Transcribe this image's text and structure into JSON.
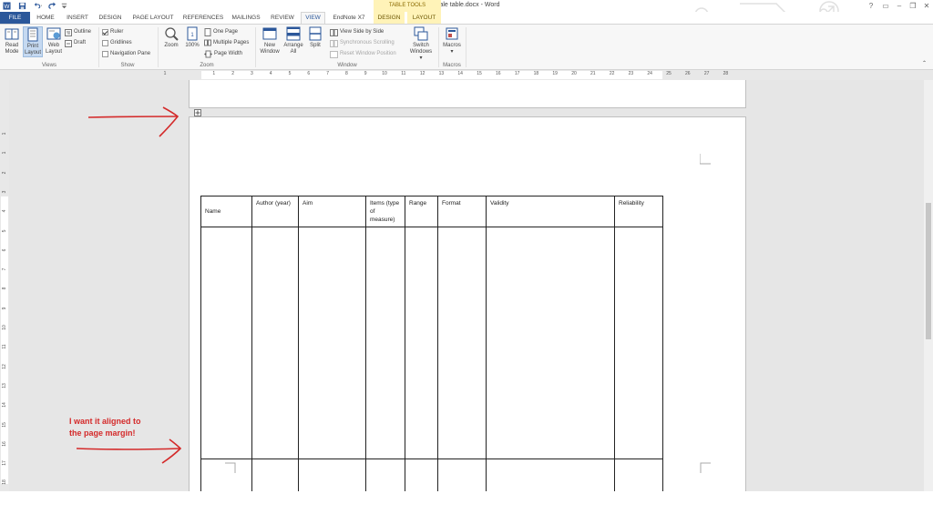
{
  "title_bar": {
    "document_title": "scale table.docx - Word",
    "table_tools": "TABLE TOOLS",
    "help": "?",
    "restore_ribbon": "▭",
    "minimize": "–",
    "maximize": "❐",
    "close": "✕"
  },
  "tabs": {
    "file": "FILE",
    "home": "HOME",
    "insert": "INSERT",
    "design": "DESIGN",
    "page_layout": "PAGE LAYOUT",
    "references": "REFERENCES",
    "mailings": "MAILINGS",
    "review": "REVIEW",
    "view": "VIEW",
    "endnote": "EndNote X7",
    "tt_design": "DESIGN",
    "tt_layout": "LAYOUT"
  },
  "ribbon": {
    "views": {
      "read_mode": [
        "Read",
        "Mode"
      ],
      "print_layout": [
        "Print",
        "Layout"
      ],
      "web_layout": [
        "Web",
        "Layout"
      ],
      "outline": "Outline",
      "draft": "Draft",
      "label": "Views"
    },
    "show": {
      "ruler": "Ruler",
      "gridlines": "Gridlines",
      "navigation_pane": "Navigation Pane",
      "label": "Show",
      "ruler_checked": true,
      "gridlines_checked": false,
      "navigation_checked": false
    },
    "zoom": {
      "zoom": "Zoom",
      "hundred": "100%",
      "one_page": "One Page",
      "multiple_pages": "Multiple Pages",
      "page_width": "Page Width",
      "label": "Zoom"
    },
    "window": {
      "new_window": [
        "New",
        "Window"
      ],
      "arrange_all": [
        "Arrange",
        "All"
      ],
      "split": "Split",
      "view_side_by_side": "View Side by Side",
      "synchronous_scrolling": "Synchronous Scrolling",
      "reset_window_position": "Reset Window Position",
      "switch_windows": [
        "Switch",
        "Windows ▾"
      ],
      "label": "Window"
    },
    "macros": {
      "macros": [
        "Macros",
        "▾"
      ],
      "label": "Macros"
    }
  },
  "ruler": {
    "h_numbers": [
      "1",
      "1",
      "2",
      "3",
      "4",
      "5",
      "6",
      "7",
      "8",
      "9",
      "10",
      "11",
      "12",
      "13",
      "14",
      "15",
      "16",
      "17",
      "18",
      "19",
      "20",
      "21",
      "22",
      "23",
      "24",
      "25",
      "26",
      "27",
      "28"
    ],
    "v_numbers": [
      "1",
      "1",
      "2",
      "3",
      "4",
      "5",
      "6",
      "7",
      "8",
      "9",
      "10",
      "11",
      "12",
      "13",
      "14",
      "15",
      "16",
      "17",
      "18",
      "19"
    ]
  },
  "table": {
    "headers": [
      "Name",
      "Author (year)",
      "Aim",
      "Items (type of measure)",
      "Range",
      "Format",
      "Validity",
      "Reliability"
    ]
  },
  "annotations": {
    "note": [
      "I want it aligned to",
      "the page margin!"
    ],
    "color": "#d42a2a"
  },
  "colors": {
    "accent": "#2b579a",
    "table_tools": "#fff3b8"
  }
}
